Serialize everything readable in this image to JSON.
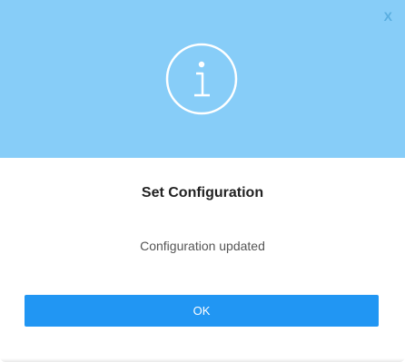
{
  "dialog": {
    "title": "Set Configuration",
    "message": "Configuration updated",
    "close_label": "X",
    "ok_label": "OK",
    "icon": "info-icon"
  },
  "colors": {
    "header_background": "#87cdf8",
    "button_background": "#2196f3",
    "button_text": "#ffffff",
    "icon_stroke": "#ffffff"
  }
}
